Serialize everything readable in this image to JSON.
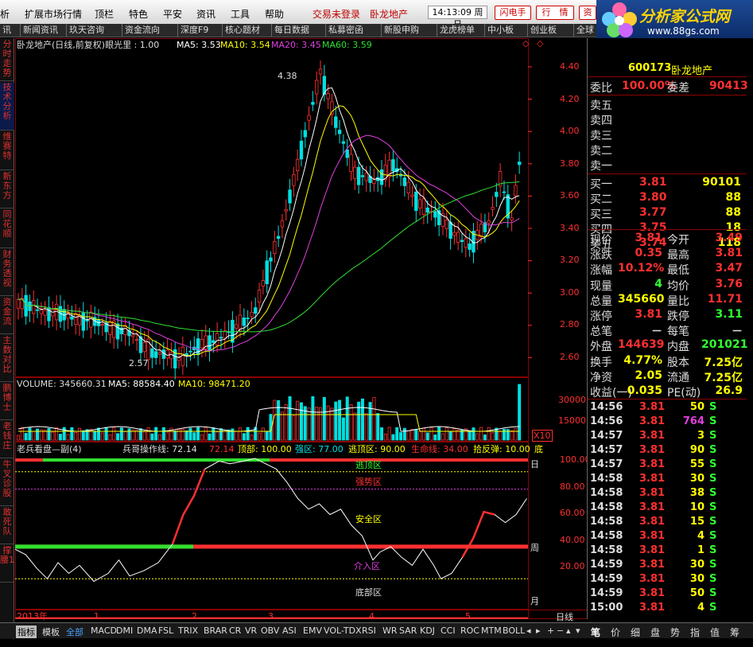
{
  "menu": {
    "items": [
      "析",
      "扩展市场行情",
      "顶栏",
      "特色",
      "平安",
      "资讯",
      "工具",
      "帮助"
    ],
    "login": "交易未登录",
    "stock": "卧龙地产",
    "clock": "14:13:09 周日",
    "btn_flash": "闪电手",
    "btn_quote": "行　情",
    "btn_info": "资"
  },
  "logo": {
    "text": "分析家公式网",
    "url": "www.88gs.com"
  },
  "tabs": [
    "讯",
    "新闻资讯",
    "玖天咨询",
    "资金流向",
    "深度F9",
    "核心题材",
    "每日数据",
    "私募密函",
    "新股申购",
    "龙虎榜单",
    "中小板",
    "创业板",
    "全球"
  ],
  "sidebar": [
    "分时走势",
    "技术分析",
    "维赛特",
    "新东方",
    "同花顺",
    "财务透视",
    "资金流",
    "主数对比",
    "鹏博士",
    "老钱庄",
    "牛叉诊股",
    "敢死队",
    "撑腰1"
  ],
  "kline": {
    "header_name": "卧龙地产(日线,前复权)眼光里 : 1.00",
    "ma5": "MA5: 3.53",
    "ma10": "MA10: 3.54",
    "ma20": "MA20: 3.45",
    "ma60": "MA60: 3.59",
    "peak": "4.38",
    "low": "2.57",
    "yaxis": [
      "4.40",
      "4.20",
      "4.00",
      "3.80",
      "3.60",
      "3.40",
      "3.20",
      "3.00",
      "2.80",
      "2.60"
    ]
  },
  "volume": {
    "header": "VOLUME: 345660.31",
    "ma5": "MA5: 88584.40",
    "ma10": "MA10: 98471.20",
    "yaxis": [
      "30000",
      "15000"
    ],
    "unit": "X10"
  },
  "indicator": {
    "name": "老兵看盘—副(4)",
    "line": "兵哥操作线: 72.14",
    "line_val": "72.14",
    "top": "顶部: 100.00",
    "strong": "强区: 77.00",
    "escape": "逃顶区: 90.00",
    "life": "生命线: 34.00",
    "pick": "拾反弹: 10.00",
    "bottom": "底",
    "zones": {
      "escape": "逃顶区",
      "strong": "强势区",
      "safe": "安全区",
      "buy": "介入区",
      "bottom": "底部区"
    },
    "yaxis": [
      "100.00",
      "80.00",
      "60.00",
      "40.00",
      "20.00"
    ],
    "right_day": "日",
    "right_week": "周",
    "right_month": "月"
  },
  "timeline": {
    "labels": [
      "2013年",
      "1",
      "2",
      "3",
      "4",
      "5"
    ],
    "period": "日线"
  },
  "quote": {
    "code": "600173",
    "name": "卧龙地产",
    "weibi_label": "委比",
    "weibi": "100.00%",
    "weicha_label": "委差",
    "weicha": "90413",
    "sells": [
      "卖五",
      "卖四",
      "卖三",
      "卖二",
      "卖一"
    ],
    "buys": [
      {
        "label": "买一",
        "price": "3.81",
        "vol": "90101"
      },
      {
        "label": "买二",
        "price": "3.80",
        "vol": "88"
      },
      {
        "label": "买三",
        "price": "3.77",
        "vol": "88"
      },
      {
        "label": "买四",
        "price": "3.75",
        "vol": "18"
      },
      {
        "label": "买五",
        "price": "3.74",
        "vol": "118"
      }
    ],
    "stats": [
      {
        "l1": "现价",
        "v1": "3.81",
        "c1": "#ff3030",
        "l2": "今开",
        "v2": "3.49",
        "c2": "#ff3030"
      },
      {
        "l1": "涨跌",
        "v1": "0.35",
        "c1": "#ff3030",
        "l2": "最高",
        "v2": "3.81",
        "c2": "#ff3030"
      },
      {
        "l1": "涨幅",
        "v1": "10.12%",
        "c1": "#ff3030",
        "l2": "最低",
        "v2": "3.47",
        "c2": "#ff3030"
      },
      {
        "l1": "现量",
        "v1": "4",
        "c1": "#30ff30",
        "l2": "均价",
        "v2": "3.76",
        "c2": "#ff3030"
      },
      {
        "l1": "总量",
        "v1": "345660",
        "c1": "#ffff00",
        "l2": "量比",
        "v2": "11.71",
        "c2": "#ff3030"
      },
      {
        "l1": "涨停",
        "v1": "3.81",
        "c1": "#ff3030",
        "l2": "跌停",
        "v2": "3.11",
        "c2": "#30ff30"
      },
      {
        "l1": "总笔",
        "v1": "－",
        "c1": "#dddddd",
        "l2": "每笔",
        "v2": "－",
        "c2": "#dddddd"
      },
      {
        "l1": "外盘",
        "v1": "144639",
        "c1": "#ff3030",
        "l2": "内盘",
        "v2": "201021",
        "c2": "#30ff30"
      },
      {
        "l1": "换手",
        "v1": "4.77%",
        "c1": "#ffff00",
        "l2": "股本",
        "v2": "7.25亿",
        "c2": "#ffff00"
      },
      {
        "l1": "净资",
        "v1": "2.05",
        "c1": "#ffff00",
        "l2": "流通",
        "v2": "7.25亿",
        "c2": "#ffff00"
      },
      {
        "l1": "收益(一)",
        "v1": "0.035",
        "c1": "#ffff00",
        "l2": "PE(动)",
        "v2": "26.9",
        "c2": "#ffff00"
      }
    ],
    "ticks": [
      {
        "time": "14:56",
        "price": "3.81",
        "vol": "50",
        "vcolor": "#ffff00",
        "side": "S"
      },
      {
        "time": "14:56",
        "price": "3.81",
        "vol": "764",
        "vcolor": "#e040e0",
        "side": "S"
      },
      {
        "time": "14:57",
        "price": "3.81",
        "vol": "3",
        "vcolor": "#ffff00",
        "side": "S"
      },
      {
        "time": "14:57",
        "price": "3.81",
        "vol": "90",
        "vcolor": "#ffff00",
        "side": "S"
      },
      {
        "time": "14:57",
        "price": "3.81",
        "vol": "55",
        "vcolor": "#ffff00",
        "side": "S"
      },
      {
        "time": "14:58",
        "price": "3.81",
        "vol": "30",
        "vcolor": "#ffff00",
        "side": "S"
      },
      {
        "time": "14:58",
        "price": "3.81",
        "vol": "38",
        "vcolor": "#ffff00",
        "side": "S"
      },
      {
        "time": "14:58",
        "price": "3.81",
        "vol": "10",
        "vcolor": "#ffff00",
        "side": "S"
      },
      {
        "time": "14:58",
        "price": "3.81",
        "vol": "15",
        "vcolor": "#ffff00",
        "side": "S"
      },
      {
        "time": "14:58",
        "price": "3.81",
        "vol": "4",
        "vcolor": "#ffff00",
        "side": "S"
      },
      {
        "time": "14:58",
        "price": "3.81",
        "vol": "1",
        "vcolor": "#ffff00",
        "side": "S"
      },
      {
        "time": "14:59",
        "price": "3.81",
        "vol": "30",
        "vcolor": "#ffff00",
        "side": "S"
      },
      {
        "time": "14:59",
        "price": "3.81",
        "vol": "30",
        "vcolor": "#ffff00",
        "side": "S"
      },
      {
        "time": "14:59",
        "price": "3.81",
        "vol": "50",
        "vcolor": "#ffff00",
        "side": "S"
      },
      {
        "time": "15:00",
        "price": "3.81",
        "vol": "4",
        "vcolor": "#ffff00",
        "side": "S"
      }
    ]
  },
  "bottom_tabs": [
    "指标",
    "模板",
    "全部",
    "MACD",
    "DMI",
    "DMA",
    "FSL",
    "TRIX",
    "BRAR",
    "CR",
    "VR",
    "OBV",
    "ASI",
    "EMV",
    "VOL-TDX",
    "RSI",
    "WR",
    "SAR",
    "KDJ",
    "CCI",
    "ROC",
    "MTM",
    "BOLL"
  ],
  "quote_tabs": [
    "笔",
    "价",
    "细",
    "盘",
    "势",
    "指",
    "值",
    "筹"
  ],
  "colors": {
    "up": "#ff3030",
    "down": "#00e0e0",
    "ma5": "#ffffff",
    "ma10": "#ffff00",
    "ma20": "#e040e0",
    "ma60": "#30e030",
    "grid": "#8b0000"
  }
}
